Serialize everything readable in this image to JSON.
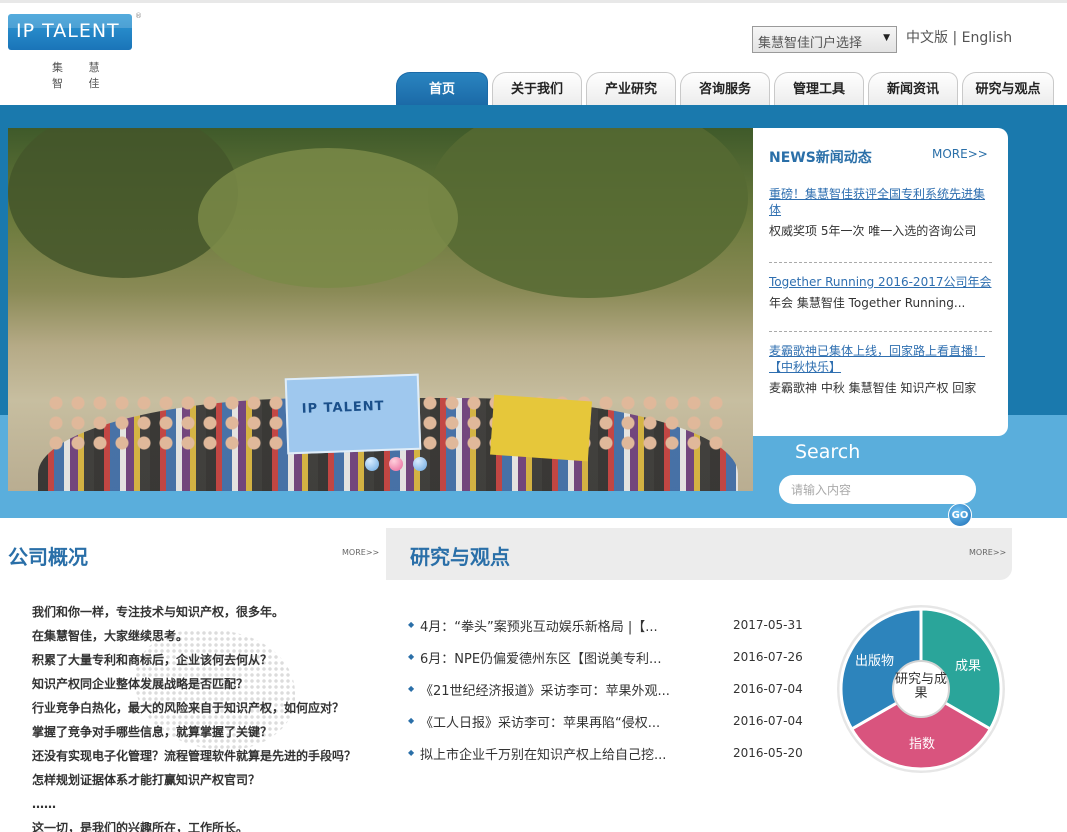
{
  "logo": {
    "brand": "IP TALENT",
    "tagline": "集 慧 智 佳"
  },
  "header": {
    "portal_select": "集慧智佳门户选择",
    "lang_cn": "中文版",
    "lang_sep": "|",
    "lang_en": "English"
  },
  "nav": {
    "items": [
      {
        "label": "首页"
      },
      {
        "label": "关于我们"
      },
      {
        "label": "产业研究"
      },
      {
        "label": "咨询服务"
      },
      {
        "label": "管理工具"
      },
      {
        "label": "新闻资讯"
      },
      {
        "label": "研究与观点"
      }
    ]
  },
  "banner": {
    "flag_text": "IP TALENT",
    "slides": 3,
    "active_slide": 2
  },
  "news": {
    "title": "NEWS新闻动态",
    "more": "MORE>>",
    "items": [
      {
        "link": "重磅！集慧智佳获评全国专利系统先进集体",
        "desc": "权威奖项 5年一次 唯一入选的咨询公司"
      },
      {
        "link": "Together Running 2016-2017公司年会",
        "desc": "年会 集慧智佳 Together Running..."
      },
      {
        "link": "麦霸歌神已集体上线，回家路上看直播！【中秋快乐】",
        "desc": "麦霸歌神 中秋 集慧智佳 知识产权 回家"
      }
    ]
  },
  "search": {
    "label": "Search",
    "placeholder": "请输入内容",
    "go": "GO"
  },
  "company": {
    "title": "公司概况",
    "more": "MORE>>",
    "lines": [
      "我们和你一样，专注技术与知识产权，很多年。",
      "在集慧智佳，大家继续思考。",
      "积累了大量专利和商标后，企业该何去何从？",
      "知识产权同企业整体发展战略是否匹配？",
      "行业竞争白热化，最大的风险来自于知识产权，如何应对？",
      "掌握了竞争对手哪些信息，就算掌握了关键？",
      "还没有实现电子化管理？流程管理软件就算是先进的手段吗？",
      "怎样规划证据体系才能打赢知识产权官司？",
      "……",
      "这一切，是我们的兴趣所在，工作所长。"
    ]
  },
  "research": {
    "title": "研究与观点",
    "more": "MORE>>",
    "items": [
      {
        "title": "4月：“拳头”案预兆互动娱乐新格局 |【...",
        "date": "2017-05-31"
      },
      {
        "title": "6月：NPE仍偏爱德州东区【图说美专利...",
        "date": "2016-07-26"
      },
      {
        "title": "《21世纪经济报道》采访李可：苹果外观...",
        "date": "2016-07-04"
      },
      {
        "title": "《工人日报》采访李可：苹果再陷“侵权...",
        "date": "2016-07-04"
      },
      {
        "title": "拟上市企业千万别在知识产权上给自己挖...",
        "date": "2016-05-20"
      }
    ],
    "pie": {
      "center": "研究与成果",
      "segments": [
        {
          "label": "出版物",
          "color": "#2d84bc"
        },
        {
          "label": "成果",
          "color": "#2aa59a"
        },
        {
          "label": "指数",
          "color": "#d9547e"
        }
      ]
    }
  },
  "colors": {
    "brand_blue": "#1a79ad",
    "light_blue": "#5aaedc",
    "link": "#2f6fb0"
  }
}
